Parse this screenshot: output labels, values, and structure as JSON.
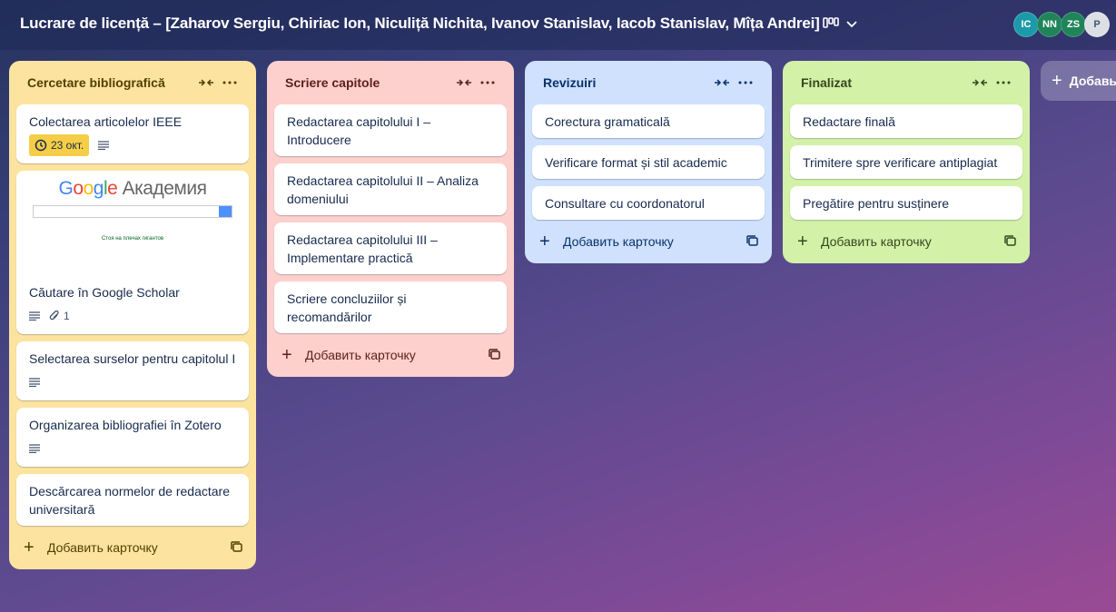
{
  "board": {
    "title": "Lucrare de licență – [Zaharov Sergiu, Chiriac Ion, Niculiță Nichita, Ivanov Stanislav, Iacob Stanislav, Mîța Andrei]"
  },
  "members": [
    {
      "initials": "IC",
      "color": "#1d9aaa"
    },
    {
      "initials": "NN",
      "color": "#1f845a"
    },
    {
      "initials": "ZS",
      "color": "#1f845a"
    },
    {
      "initials": "P",
      "color": "#dcdfe4"
    }
  ],
  "add_list_label": "Добавь",
  "lists": [
    {
      "title": "Cercetare bibliografică",
      "bg": "#fce4a0",
      "fg": "#533f04",
      "add_label": "Добавить карточку",
      "cards": [
        {
          "title": "Colectarea articolelor IEEE",
          "date": "23 окт.",
          "description": true
        },
        {
          "title": "Căutare în Google Scholar",
          "cover": {
            "logo_google": "Google",
            "logo_rest": "Академия",
            "tagline": "Стоя на плечах гигантов"
          },
          "description": true,
          "attachments": "1"
        },
        {
          "title": "Selectarea surselor pentru capitolul I",
          "description": true
        },
        {
          "title": "Organizarea bibliografiei în Zotero",
          "description": true
        },
        {
          "title": "Descărcarea normelor de redactare universitară"
        }
      ]
    },
    {
      "title": "Scriere capitole",
      "bg": "#fdd0cd",
      "fg": "#5d1f1a",
      "add_label": "Добавить карточку",
      "cards": [
        {
          "title": "Redactarea capitolului I – Introducere"
        },
        {
          "title": "Redactarea capitolului II – Analiza domeniului"
        },
        {
          "title": "Redactarea capitolului III – Implementare practică"
        },
        {
          "title": "Scriere concluziilor și recomandărilor"
        }
      ]
    },
    {
      "title": "Revizuiri",
      "bg": "#cfe1fd",
      "fg": "#09326c",
      "add_label": "Добавить карточку",
      "cards": [
        {
          "title": "Corectura gramaticală"
        },
        {
          "title": "Verificare format și stil academic"
        },
        {
          "title": "Consultare cu coordonatorul"
        }
      ]
    },
    {
      "title": "Finalizat",
      "bg": "#d3f1a7",
      "fg": "#37471f",
      "add_label": "Добавить карточку",
      "cards": [
        {
          "title": "Redactare finală"
        },
        {
          "title": "Trimitere spre verificare antiplagiat"
        },
        {
          "title": "Pregătire pentru susținere"
        }
      ]
    }
  ]
}
